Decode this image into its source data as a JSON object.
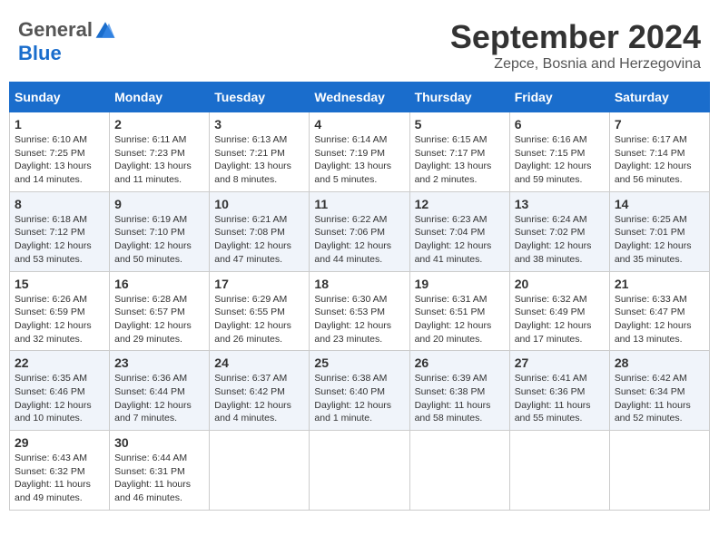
{
  "header": {
    "logo_general": "General",
    "logo_blue": "Blue",
    "month_title": "September 2024",
    "location": "Zepce, Bosnia and Herzegovina"
  },
  "days_of_week": [
    "Sunday",
    "Monday",
    "Tuesday",
    "Wednesday",
    "Thursday",
    "Friday",
    "Saturday"
  ],
  "weeks": [
    [
      {
        "day": "1",
        "sunrise": "6:10 AM",
        "sunset": "7:25 PM",
        "daylight": "13 hours and 14 minutes."
      },
      {
        "day": "2",
        "sunrise": "6:11 AM",
        "sunset": "7:23 PM",
        "daylight": "13 hours and 11 minutes."
      },
      {
        "day": "3",
        "sunrise": "6:13 AM",
        "sunset": "7:21 PM",
        "daylight": "13 hours and 8 minutes."
      },
      {
        "day": "4",
        "sunrise": "6:14 AM",
        "sunset": "7:19 PM",
        "daylight": "13 hours and 5 minutes."
      },
      {
        "day": "5",
        "sunrise": "6:15 AM",
        "sunset": "7:17 PM",
        "daylight": "13 hours and 2 minutes."
      },
      {
        "day": "6",
        "sunrise": "6:16 AM",
        "sunset": "7:15 PM",
        "daylight": "12 hours and 59 minutes."
      },
      {
        "day": "7",
        "sunrise": "6:17 AM",
        "sunset": "7:14 PM",
        "daylight": "12 hours and 56 minutes."
      }
    ],
    [
      {
        "day": "8",
        "sunrise": "6:18 AM",
        "sunset": "7:12 PM",
        "daylight": "12 hours and 53 minutes."
      },
      {
        "day": "9",
        "sunrise": "6:19 AM",
        "sunset": "7:10 PM",
        "daylight": "12 hours and 50 minutes."
      },
      {
        "day": "10",
        "sunrise": "6:21 AM",
        "sunset": "7:08 PM",
        "daylight": "12 hours and 47 minutes."
      },
      {
        "day": "11",
        "sunrise": "6:22 AM",
        "sunset": "7:06 PM",
        "daylight": "12 hours and 44 minutes."
      },
      {
        "day": "12",
        "sunrise": "6:23 AM",
        "sunset": "7:04 PM",
        "daylight": "12 hours and 41 minutes."
      },
      {
        "day": "13",
        "sunrise": "6:24 AM",
        "sunset": "7:02 PM",
        "daylight": "12 hours and 38 minutes."
      },
      {
        "day": "14",
        "sunrise": "6:25 AM",
        "sunset": "7:01 PM",
        "daylight": "12 hours and 35 minutes."
      }
    ],
    [
      {
        "day": "15",
        "sunrise": "6:26 AM",
        "sunset": "6:59 PM",
        "daylight": "12 hours and 32 minutes."
      },
      {
        "day": "16",
        "sunrise": "6:28 AM",
        "sunset": "6:57 PM",
        "daylight": "12 hours and 29 minutes."
      },
      {
        "day": "17",
        "sunrise": "6:29 AM",
        "sunset": "6:55 PM",
        "daylight": "12 hours and 26 minutes."
      },
      {
        "day": "18",
        "sunrise": "6:30 AM",
        "sunset": "6:53 PM",
        "daylight": "12 hours and 23 minutes."
      },
      {
        "day": "19",
        "sunrise": "6:31 AM",
        "sunset": "6:51 PM",
        "daylight": "12 hours and 20 minutes."
      },
      {
        "day": "20",
        "sunrise": "6:32 AM",
        "sunset": "6:49 PM",
        "daylight": "12 hours and 17 minutes."
      },
      {
        "day": "21",
        "sunrise": "6:33 AM",
        "sunset": "6:47 PM",
        "daylight": "12 hours and 13 minutes."
      }
    ],
    [
      {
        "day": "22",
        "sunrise": "6:35 AM",
        "sunset": "6:46 PM",
        "daylight": "12 hours and 10 minutes."
      },
      {
        "day": "23",
        "sunrise": "6:36 AM",
        "sunset": "6:44 PM",
        "daylight": "12 hours and 7 minutes."
      },
      {
        "day": "24",
        "sunrise": "6:37 AM",
        "sunset": "6:42 PM",
        "daylight": "12 hours and 4 minutes."
      },
      {
        "day": "25",
        "sunrise": "6:38 AM",
        "sunset": "6:40 PM",
        "daylight": "12 hours and 1 minute."
      },
      {
        "day": "26",
        "sunrise": "6:39 AM",
        "sunset": "6:38 PM",
        "daylight": "11 hours and 58 minutes."
      },
      {
        "day": "27",
        "sunrise": "6:41 AM",
        "sunset": "6:36 PM",
        "daylight": "11 hours and 55 minutes."
      },
      {
        "day": "28",
        "sunrise": "6:42 AM",
        "sunset": "6:34 PM",
        "daylight": "11 hours and 52 minutes."
      }
    ],
    [
      {
        "day": "29",
        "sunrise": "6:43 AM",
        "sunset": "6:32 PM",
        "daylight": "11 hours and 49 minutes."
      },
      {
        "day": "30",
        "sunrise": "6:44 AM",
        "sunset": "6:31 PM",
        "daylight": "11 hours and 46 minutes."
      },
      null,
      null,
      null,
      null,
      null
    ]
  ],
  "labels": {
    "sunrise": "Sunrise:",
    "sunset": "Sunset:",
    "daylight": "Daylight hours"
  }
}
